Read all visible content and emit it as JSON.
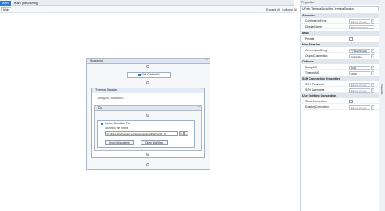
{
  "tabs": [
    {
      "label": "Main"
    },
    {
      "label": "Main (ReadOnly)"
    }
  ],
  "breadcrumb": "Main",
  "toolbar": {
    "expand_all": "Expand All",
    "collapse_all": "Collapse All"
  },
  "sequence": {
    "title": "Sequence",
    "get_credential": "Get Credential",
    "terminal_session": {
      "title": "Terminal Session",
      "configure": "Configure Connection...",
      "do": {
        "title": "Do",
        "invoke": {
          "title": "Invoke Workflow File",
          "file_label": "Workflow file name",
          "file_value": "\"C:\\\\FILE-DFZ\\\\.auto\\\\.vru\\\\documents\\\\UiPath\\\\SITR_P",
          "import_label": "Import Arguments",
          "open_label": "Open Workflow"
        }
      }
    }
  },
  "properties": {
    "title": "Properties",
    "class_name": "UiPath.Terminal.Activities.TerminalSession",
    "sections": {
      "common": "Common",
      "misc": "Misc",
      "new_session": "New Session",
      "options": "Options",
      "ssh": "SSH Connection Properties",
      "existing": "Use Existing Connection"
    },
    "rows": {
      "continue_on_error": {
        "name": "ContinueOnError",
        "value": "Enter a VB expr"
      },
      "display_name": {
        "name": "DisplayName",
        "value": "Terminal Session"
      },
      "private": {
        "name": "Private"
      },
      "connection_string": {
        "name": "ConnectionString",
        "value": "\"{\\\"AttachExistin"
      },
      "output_connection": {
        "name": "OutputConnection",
        "value": "connection"
      },
      "delay_ms": {
        "name": "DelayMS",
        "value": "1000"
      },
      "timeout_ms": {
        "name": "TimeoutMS",
        "value": "30000"
      },
      "ssh_password": {
        "name": "SSH Password",
        "value": "Enter a VB expr"
      },
      "ssh_username": {
        "name": "SSH Username",
        "value": "Enter a VB expr"
      },
      "close_connection": {
        "name": "CloseConnection"
      },
      "existing_connection": {
        "name": "ExistingConnection",
        "value": "Enter a VB expr"
      }
    }
  },
  "right_panel_tab": "Properties"
}
